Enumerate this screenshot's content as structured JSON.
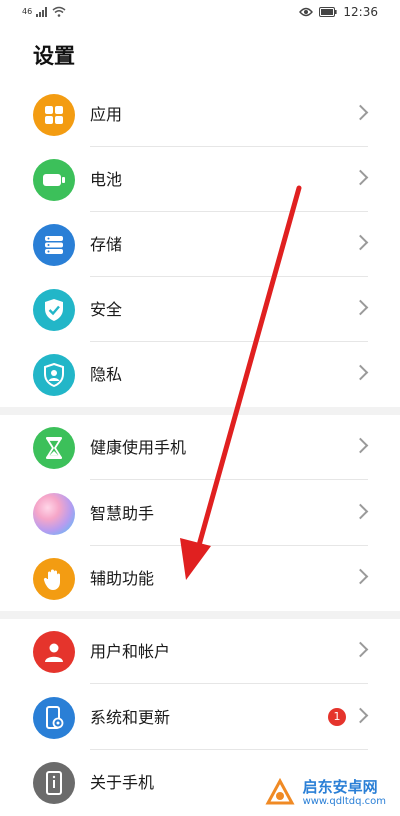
{
  "status_bar": {
    "signal_text": "46",
    "time": "12:36",
    "icons": [
      "signal-icon",
      "wifi-icon",
      "eye-icon",
      "battery-icon"
    ]
  },
  "page": {
    "title": "设置"
  },
  "groups": [
    {
      "items": [
        {
          "label": "应用",
          "icon": "apps-icon",
          "color": "#f39c12"
        },
        {
          "label": "电池",
          "icon": "battery-icon",
          "color": "#3cc05a"
        },
        {
          "label": "存储",
          "icon": "storage-icon",
          "color": "#2a7fd6"
        },
        {
          "label": "安全",
          "icon": "shield-check-icon",
          "color": "#22b6c8"
        },
        {
          "label": "隐私",
          "icon": "privacy-icon",
          "color": "#22b6c8"
        }
      ]
    },
    {
      "items": [
        {
          "label": "健康使用手机",
          "icon": "hourglass-icon",
          "color": "#3cc05a"
        },
        {
          "label": "智慧助手",
          "icon": "assistant-icon",
          "color": "#a98fe3"
        },
        {
          "label": "辅助功能",
          "icon": "hand-icon",
          "color": "#f39c12"
        }
      ]
    },
    {
      "items": [
        {
          "label": "用户和帐户",
          "icon": "user-icon",
          "color": "#e5342c"
        },
        {
          "label": "系统和更新",
          "icon": "phone-settings-icon",
          "color": "#2a7fd6",
          "badge": "1"
        },
        {
          "label": "关于手机",
          "icon": "phone-info-icon",
          "color": "#6b6b6b"
        }
      ]
    }
  ],
  "watermark": {
    "title": "启东安卓网",
    "url": "www.qdltdq.com"
  },
  "annotation": {
    "type": "red-arrow",
    "color": "#e02020"
  }
}
